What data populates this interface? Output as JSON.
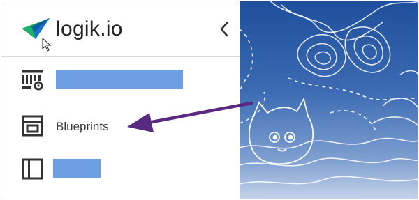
{
  "brand": {
    "name": "logik.io"
  },
  "sidebar": {
    "collapse_icon": "chevron-left-icon",
    "items": [
      {
        "icon": "grid-settings-icon",
        "label": ""
      },
      {
        "icon": "blueprint-layout-icon",
        "label": "Blueprints"
      },
      {
        "icon": "panel-layout-icon",
        "label": ""
      }
    ]
  },
  "colors": {
    "redaction": "#6f9fe3",
    "arrow": "#5a2a82",
    "background_top": "#1f4f9c",
    "background_bottom": "#c6d4ea"
  }
}
